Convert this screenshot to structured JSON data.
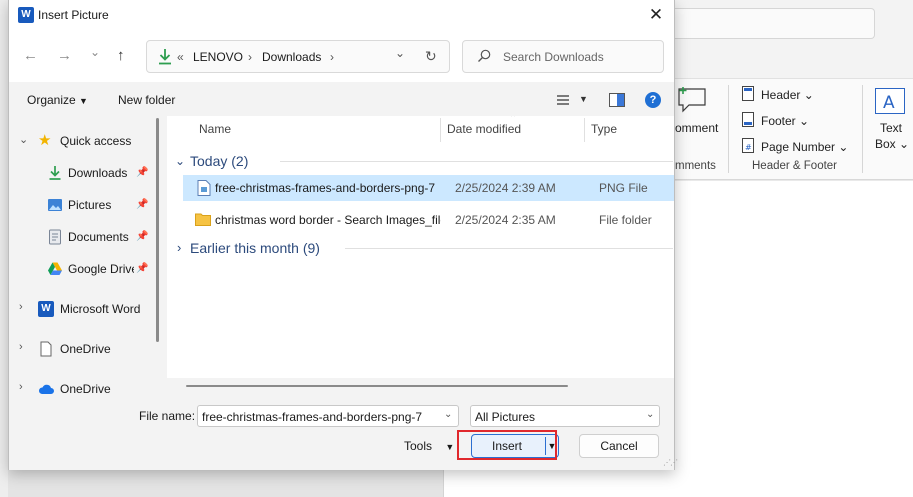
{
  "dialog": {
    "title": "Insert Picture",
    "title_icon_letter": "W",
    "close_glyph": "✕"
  },
  "nav": {
    "back_glyph": "←",
    "forward_glyph": "→",
    "recent_glyph": "⌄",
    "up_glyph": "↑",
    "breadcrumb_prefix": "«",
    "breadcrumb": [
      "LENOVO",
      "Downloads"
    ],
    "breadcrumb_sep": "›",
    "dropdown_glyph": "⌄",
    "refresh_glyph": "↻",
    "search_placeholder": "Search Downloads"
  },
  "toolbar": {
    "organize_label": "Organize",
    "new_folder_label": "New folder",
    "help_glyph": "?"
  },
  "sidebar": {
    "items": [
      {
        "label": "Quick access"
      },
      {
        "label": "Downloads"
      },
      {
        "label": "Pictures"
      },
      {
        "label": "Documents"
      },
      {
        "label": "Google Drive"
      },
      {
        "label": "Microsoft Word"
      },
      {
        "label": "OneDrive"
      },
      {
        "label": "OneDrive"
      }
    ]
  },
  "filelist": {
    "columns": {
      "name": "Name",
      "date": "Date modified",
      "type": "Type"
    },
    "groups": [
      {
        "label": "Today (2)",
        "expanded": true
      },
      {
        "label": "Earlier this month (9)",
        "expanded": false
      }
    ],
    "rows": [
      {
        "name": "free-christmas-frames-and-borders-png-7",
        "date": "2/25/2024 2:39 AM",
        "type": "PNG File",
        "selected": true
      },
      {
        "name": "christmas word border - Search Images_files",
        "date": "2/25/2024 2:35 AM",
        "type": "File folder",
        "selected": false
      }
    ]
  },
  "footer": {
    "file_name_label": "File name:",
    "file_name_value": "free-christmas-frames-and-borders-png-7",
    "filter_value": "All Pictures",
    "tools_label": "Tools",
    "insert_label": "Insert",
    "cancel_label": "Cancel"
  },
  "ribbon": {
    "comment_label": "omment",
    "comments_group": "mments",
    "header_label": "Header",
    "footer_label": "Footer",
    "page_number_label": "Page Number",
    "header_footer_group": "Header & Footer",
    "textbox_line1": "Text",
    "textbox_line2": "Box"
  },
  "colors": {
    "accent": "#185abd",
    "selection": "#cce8ff",
    "highlight_box": "#e0282c"
  }
}
